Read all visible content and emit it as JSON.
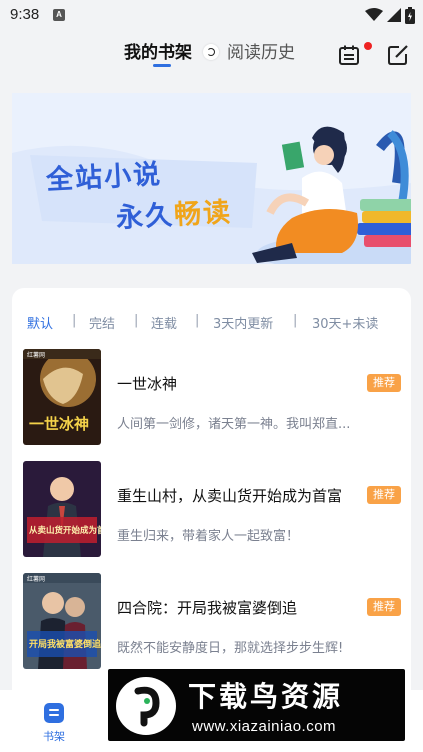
{
  "status_bar": {
    "time": "9:38",
    "notification_icon": "A"
  },
  "nav": {
    "tabs": [
      {
        "label": "我的书架",
        "active": true
      },
      {
        "label": "阅读历史",
        "active": false
      }
    ],
    "calendar_icon": "calendar-icon",
    "edit_icon": "edit-icon"
  },
  "banner": {
    "line1": "全站小说",
    "line2_a": "永久",
    "line2_b": "畅读"
  },
  "filters": [
    "默认",
    "完结",
    "连载",
    "3天内更新",
    "30天+未读"
  ],
  "books": [
    {
      "title": "一世冰神",
      "desc": "人间第一剑修，诸天第一神。我叫郑直...",
      "badge": "推荐",
      "cover_text": "一世冰神"
    },
    {
      "title": "重生山村，从卖山货开始成为首富",
      "desc": "重生归来，带着家人一起致富！",
      "badge": "推荐",
      "cover_text": "从卖山货开始成为首富"
    },
    {
      "title": "四合院：开局我被富婆倒追",
      "desc": "既然不能安静度日，那就选择步步生辉!",
      "badge": "推荐",
      "cover_text": "开局我被富婆倒追"
    }
  ],
  "bottom_nav": {
    "bookshelf_label": "书架"
  },
  "watermark": {
    "title": "下载鸟资源",
    "url": "www.xiazainiao.com"
  },
  "colors": {
    "accent": "#2f6fe0",
    "badge": "#f9a247",
    "background": "#f2f3f5"
  }
}
